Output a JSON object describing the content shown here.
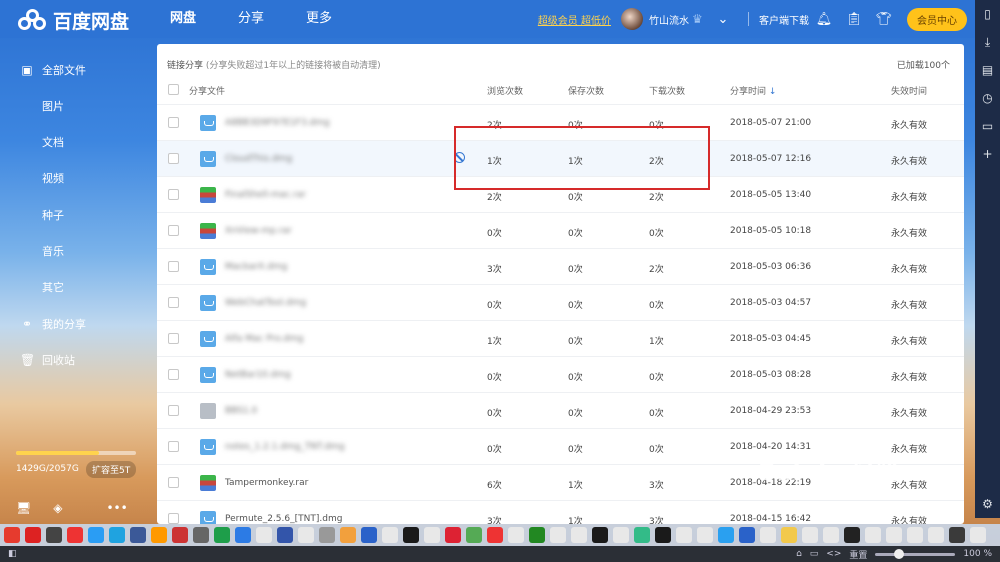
{
  "app": {
    "logo_text": "百度网盘",
    "nav": [
      "网盘",
      "分享",
      "更多"
    ],
    "vip_link": "超级会员 超低价",
    "username": "竹山流水",
    "client_download": "客户端下载",
    "member_center": "会员中心"
  },
  "sidebar": {
    "items": [
      {
        "label": "全部文件",
        "icon": "files-icon"
      },
      {
        "label": "图片"
      },
      {
        "label": "文档"
      },
      {
        "label": "视频"
      },
      {
        "label": "种子"
      },
      {
        "label": "音乐"
      },
      {
        "label": "其它"
      },
      {
        "label": "我的分享",
        "icon": "share-icon"
      },
      {
        "label": "回收站",
        "icon": "trash-icon"
      }
    ],
    "quota_text": "1429G/2057G",
    "quota_fraction": 0.69,
    "expand_label": "扩容至5T"
  },
  "panel": {
    "title": "链接分享",
    "note": "(分享失败超过1年以上的链接将被自动清理)",
    "loaded": "已加载100个",
    "columns": {
      "file": "分享文件",
      "views": "浏览次数",
      "saves": "保存次数",
      "downloads": "下载次数",
      "time": "分享时间",
      "expire": "失效时间"
    },
    "sort_arrow": "↓",
    "rows": [
      {
        "name": "A8BB3D9F97E1F3.dmg",
        "icon": "dmg",
        "views": "2次",
        "saves": "0次",
        "downloads": "0次",
        "time": "2018-05-07 21:00",
        "expire": "永久有效",
        "blur": true
      },
      {
        "name": "CloudThis.dmg",
        "icon": "dmg",
        "views": "1次",
        "saves": "1次",
        "downloads": "2次",
        "time": "2018-05-07 12:16",
        "expire": "永久有效",
        "blur": true,
        "highlight": true
      },
      {
        "name": "FinalShell-mac.rar",
        "icon": "rar",
        "views": "2次",
        "saves": "0次",
        "downloads": "2次",
        "time": "2018-05-05 13:40",
        "expire": "永久有效",
        "blur": true
      },
      {
        "name": "XnView-mp.rar",
        "icon": "rar",
        "views": "0次",
        "saves": "0次",
        "downloads": "0次",
        "time": "2018-05-05 10:18",
        "expire": "永久有效",
        "blur": true
      },
      {
        "name": "MacbarX.dmg",
        "icon": "dmg",
        "views": "3次",
        "saves": "0次",
        "downloads": "2次",
        "time": "2018-05-03 06:36",
        "expire": "永久有效",
        "blur": true
      },
      {
        "name": "WebChatTool.dmg",
        "icon": "dmg",
        "views": "0次",
        "saves": "0次",
        "downloads": "0次",
        "time": "2018-05-03 04:57",
        "expire": "永久有效",
        "blur": true
      },
      {
        "name": "Alfa Mac Pro.dmg",
        "icon": "dmg",
        "views": "1次",
        "saves": "0次",
        "downloads": "1次",
        "time": "2018-05-03 04:45",
        "expire": "永久有效",
        "blur": true
      },
      {
        "name": "NetBar10.dmg",
        "icon": "dmg",
        "views": "0次",
        "saves": "0次",
        "downloads": "0次",
        "time": "2018-05-03 08:28",
        "expire": "永久有效",
        "blur": true
      },
      {
        "name": "BBS1.0",
        "icon": "gray",
        "views": "0次",
        "saves": "0次",
        "downloads": "0次",
        "time": "2018-04-29 23:53",
        "expire": "永久有效",
        "blur": true
      },
      {
        "name": "notes_1.2.1.dmg_TNT.dmg",
        "icon": "dmg",
        "views": "0次",
        "saves": "0次",
        "downloads": "0次",
        "time": "2018-04-20 14:31",
        "expire": "永久有效",
        "blur": true
      },
      {
        "name": "Tampermonkey.rar",
        "icon": "rar",
        "views": "6次",
        "saves": "1次",
        "downloads": "3次",
        "time": "2018-04-18 22:19",
        "expire": "永久有效",
        "blur": false
      },
      {
        "name": "Permute_2.5.6_[TNT].dmg",
        "icon": "dmg",
        "views": "3次",
        "saves": "1次",
        "downloads": "3次",
        "time": "2018-04-15 16:42",
        "expire": "永久有效",
        "blur": false
      }
    ]
  },
  "statusbar": {
    "reset": "重置",
    "zoom": "100 %",
    "zoom_fraction": 0.3
  },
  "watermark": {
    "text": "Bai du 经验",
    "url": "jingyan.baidu.com"
  },
  "colors": {
    "topbar": "#2d73d4",
    "annotation": "#d62a2a",
    "vip": "#ffd34d",
    "member_button": "#ffc21a"
  }
}
